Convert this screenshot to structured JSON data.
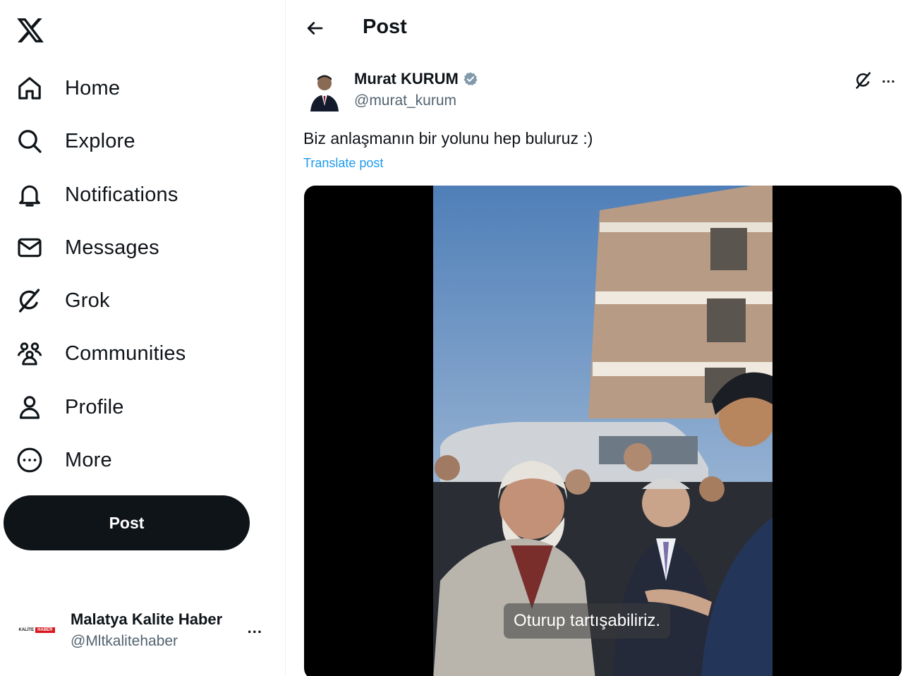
{
  "sidebar": {
    "logo": "x-logo-icon",
    "items": [
      {
        "label": "Home",
        "icon": "home-icon"
      },
      {
        "label": "Explore",
        "icon": "search-icon"
      },
      {
        "label": "Notifications",
        "icon": "bell-icon"
      },
      {
        "label": "Messages",
        "icon": "mail-icon"
      },
      {
        "label": "Grok",
        "icon": "grok-icon"
      },
      {
        "label": "Communities",
        "icon": "communities-icon"
      },
      {
        "label": "Profile",
        "icon": "person-icon"
      },
      {
        "label": "More",
        "icon": "more-circle-icon"
      }
    ],
    "post_button": "Post",
    "account": {
      "name": "Malatya Kalite Haber",
      "handle": "@Mltkalitehaber",
      "logo_text_left": "KALİTE",
      "logo_text_right": "HABER",
      "more": "..."
    }
  },
  "main": {
    "header_title": "Post",
    "post": {
      "author_name": "Murat KURUM",
      "author_handle": "@murat_kurum",
      "text": "Biz anlaşmanın bir yolunu hep buluruz :)",
      "translate_label": "Translate post",
      "more": "...",
      "video_caption": "Oturup tartışabiliriz."
    }
  },
  "colors": {
    "text": "#0f1419",
    "secondary": "#536471",
    "link": "#1d9bf0",
    "verified": "#829aab",
    "post_button_bg": "#0f1419"
  }
}
